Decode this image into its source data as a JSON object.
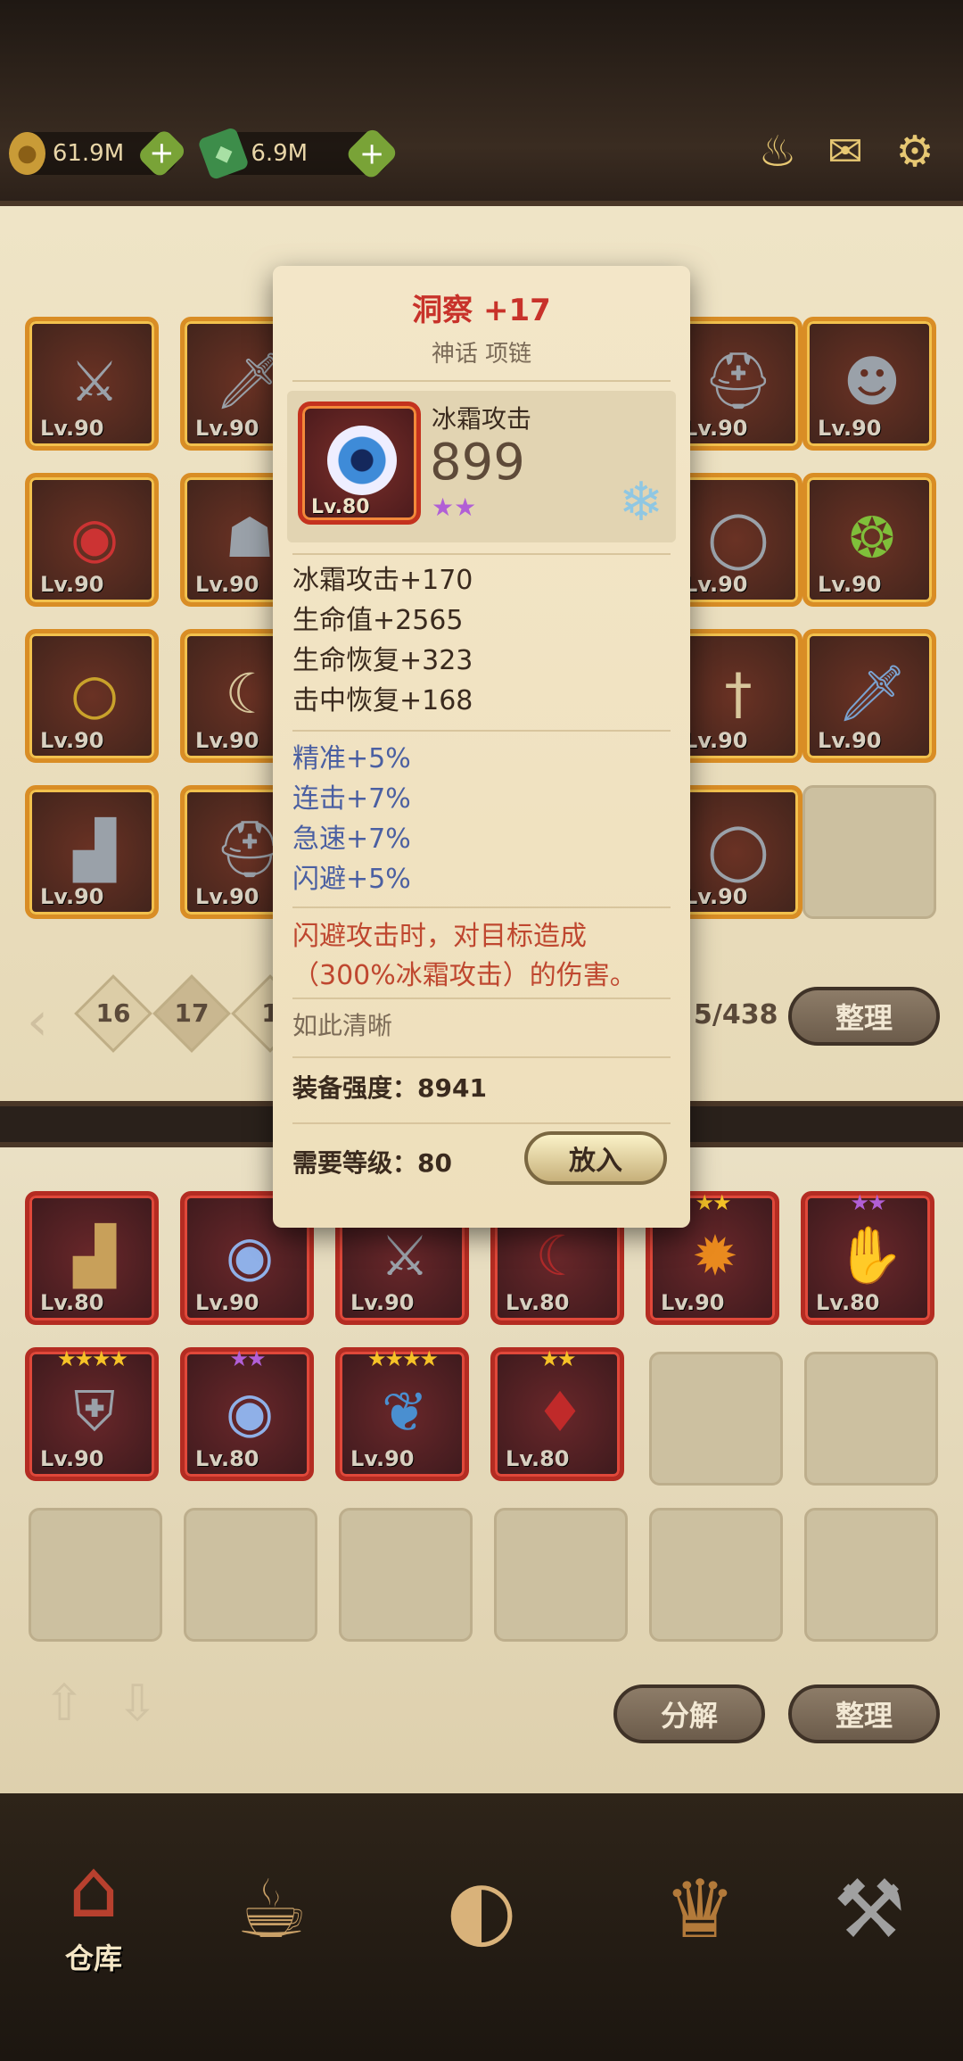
{
  "resources": [
    {
      "icon": "coin-icon",
      "value": "61.9M"
    },
    {
      "icon": "gem-icon",
      "value": "6.9M"
    }
  ],
  "top_icons": [
    "horn-icon",
    "mail-icon",
    "gear-icon"
  ],
  "inventory": {
    "rows": [
      [
        "Lv.90",
        "Lv.90",
        "",
        "",
        "Lv.90",
        "Lv.90"
      ],
      [
        "Lv.90",
        "Lv.90",
        "",
        "",
        "Lv.90",
        "Lv.90"
      ],
      [
        "Lv.90",
        "Lv.90",
        "",
        "",
        "Lv.90",
        "Lv.90"
      ],
      [
        "Lv.90",
        "Lv.90",
        "",
        "",
        "Lv.90",
        ""
      ]
    ],
    "pages": [
      "16",
      "17",
      "1"
    ],
    "count": "5/438",
    "sort_label": "整理"
  },
  "equipped": {
    "rows": [
      [
        {
          "lv": "Lv.80",
          "stars": ""
        },
        {
          "lv": "Lv.90",
          "stars": ""
        },
        {
          "lv": "Lv.90",
          "stars": ""
        },
        {
          "lv": "Lv.80",
          "stars": ""
        },
        {
          "lv": "Lv.90",
          "stars": "★★"
        },
        {
          "lv": "Lv.80",
          "stars": "★★"
        }
      ],
      [
        {
          "lv": "Lv.90",
          "stars": "★★★★"
        },
        {
          "lv": "Lv.80",
          "stars": "★★"
        },
        {
          "lv": "Lv.90",
          "stars": "★★★★"
        },
        {
          "lv": "Lv.80",
          "stars": "★★"
        },
        null,
        null
      ]
    ],
    "decompose_label": "分解",
    "sort_label": "整理"
  },
  "nav": {
    "warehouse_label": "仓库"
  },
  "tooltip": {
    "title": "洞察 +17",
    "subtitle": "神话 项链",
    "level": "Lv.80",
    "main_stat_name": "冰霜攻击",
    "main_stat_value": "899",
    "stars": "★★",
    "base_stats": [
      "冰霜攻击+170",
      "生命值+2565",
      "生命恢复+323",
      "击中恢复+168"
    ],
    "extra_stats": [
      "精准+5%",
      "连击+7%",
      "急速+7%",
      "闪避+5%"
    ],
    "skill": "闪避攻击时，对目标造成（300%冰霜攻击）的伤害。",
    "flavor": "如此清晰",
    "power_label": "装备强度：",
    "power_value": "8941",
    "req_label": "需要等级：",
    "req_value": "80",
    "put_label": "放入"
  }
}
